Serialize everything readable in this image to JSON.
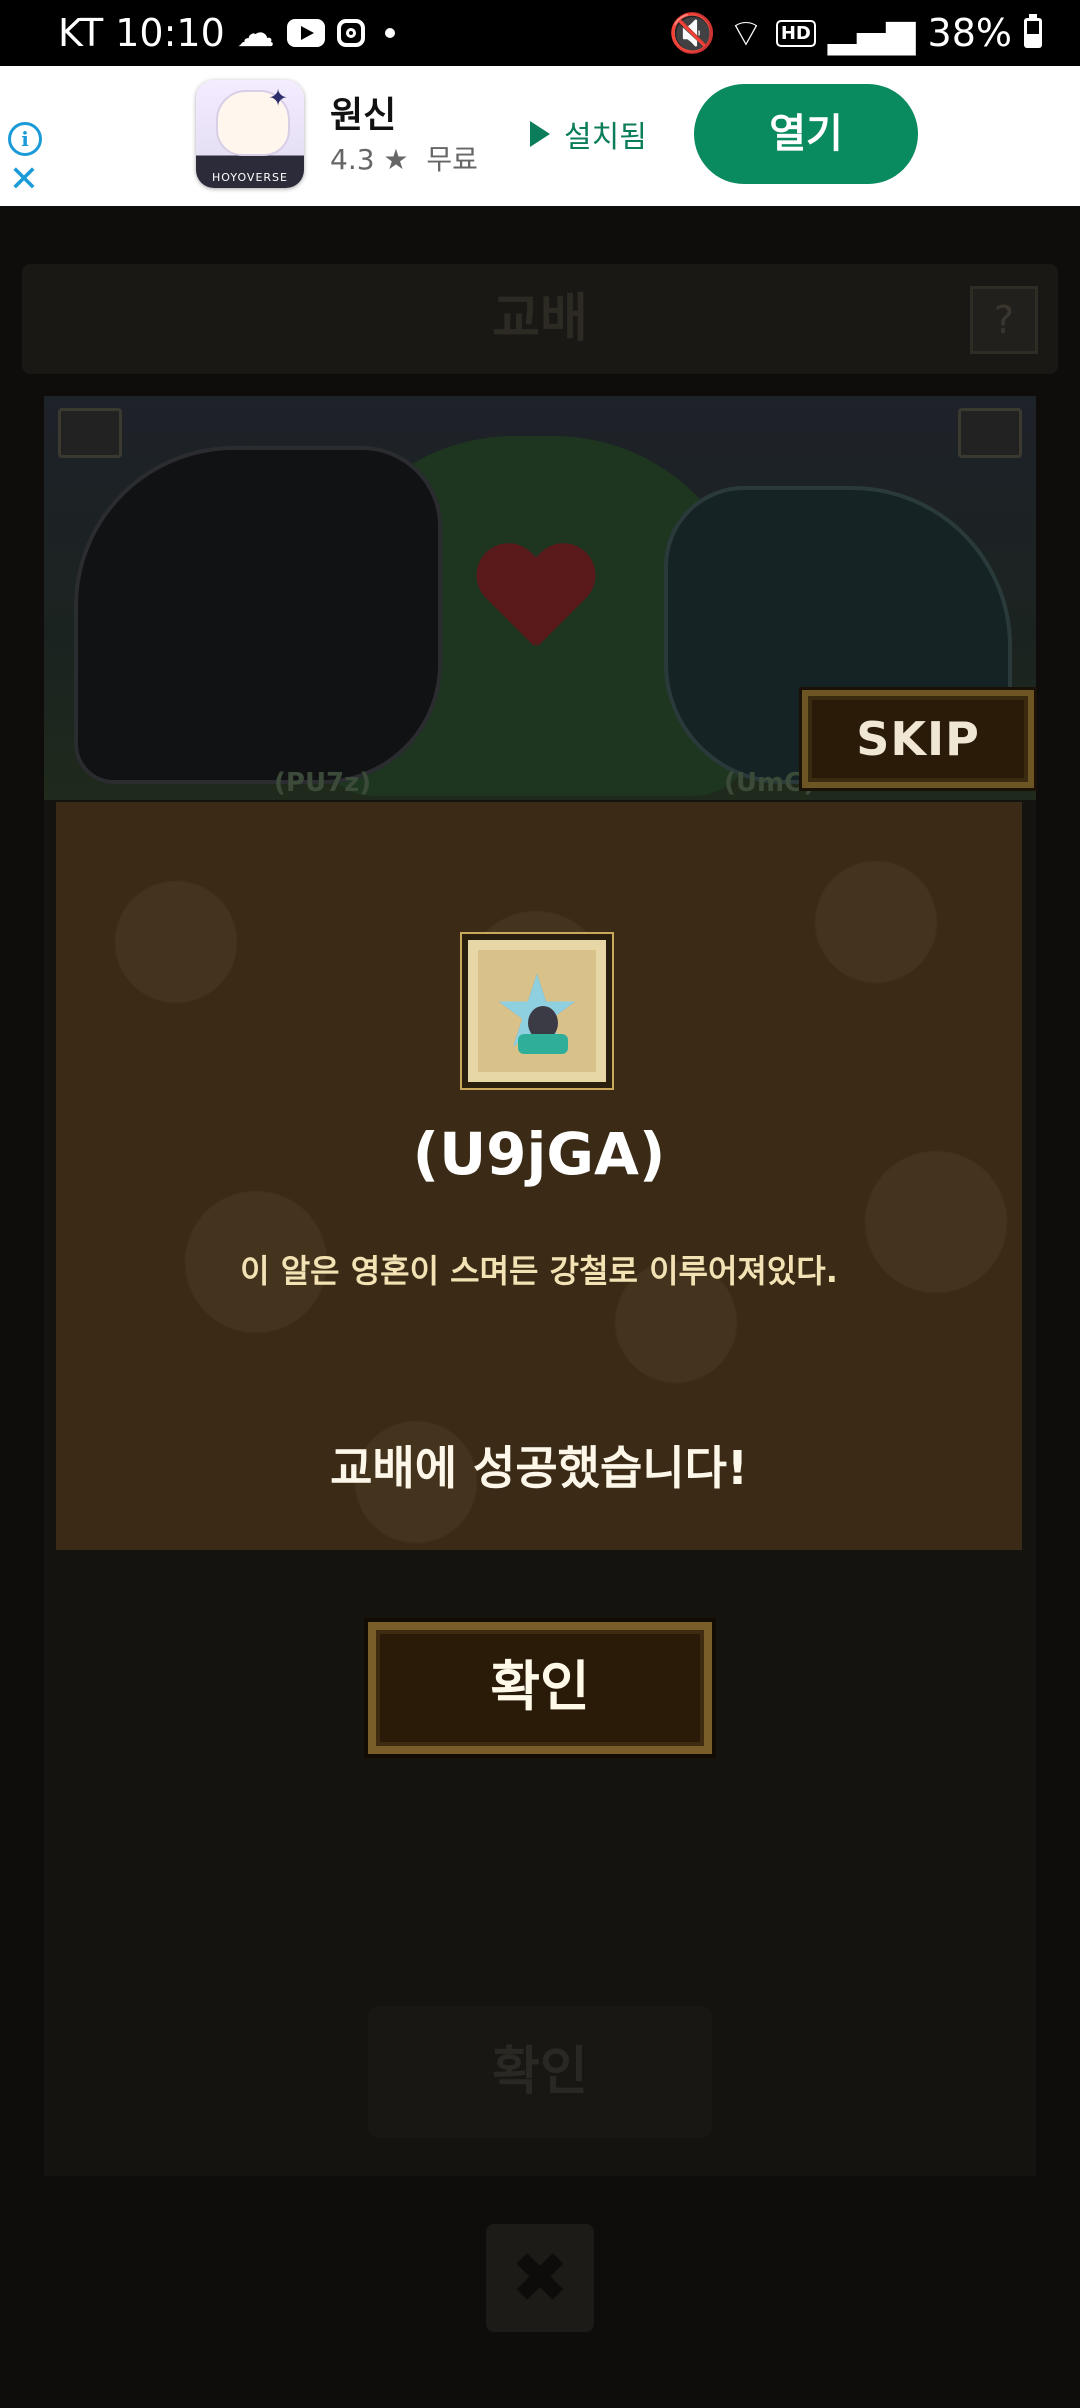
{
  "status_bar": {
    "carrier_time": "KT 10:10",
    "battery": "38%"
  },
  "ad": {
    "app_name": "원신",
    "rating": "4.3 ★",
    "price": "무료",
    "installed_label": "설치됨",
    "open_label": "열기",
    "icon_brand": "HOYOVERSE",
    "accent_color": "#0a8a5f"
  },
  "background": {
    "title": "교배",
    "help_label": "?",
    "left_name": "(PU7z)",
    "right_name": "(UmC)",
    "confirm_label": "확인",
    "close_label": "✖"
  },
  "skip_label": "SKIP",
  "result": {
    "item_name": "(U9jGA)",
    "item_description": "이 알은 영혼이 스며든 강철로 이루어져있다.",
    "success_message": "교배에 성공했습니다!",
    "confirm_label": "확인"
  }
}
